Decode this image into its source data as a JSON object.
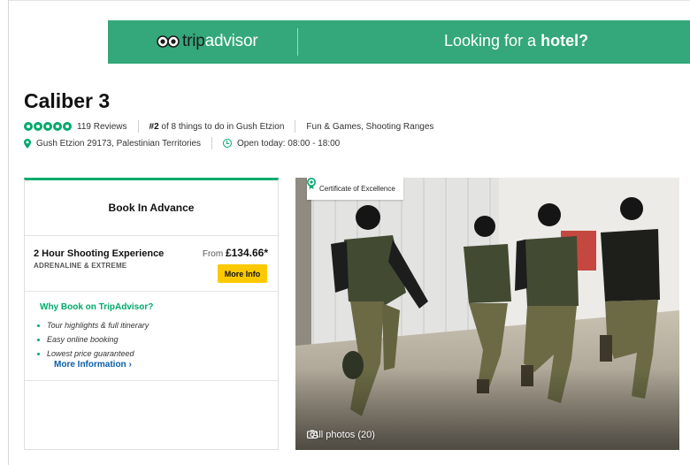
{
  "banner": {
    "logo_prefix": "trip",
    "logo_suffix": "advisor",
    "tagline_prefix": "Looking for a ",
    "tagline_emphasis": "hotel?"
  },
  "attraction": {
    "name": "Caliber 3",
    "rating_bubbles": 5,
    "reviews": "119 Reviews",
    "rank_number": "#2",
    "rank_text": " of 8 things to do in Gush Etzion",
    "categories": "Fun & Games, Shooting Ranges",
    "address": "Gush Etzion 29173, Palestinian Territories",
    "hours": "Open today: 08:00 - 18:00"
  },
  "booking": {
    "heading": "Book In Advance",
    "product_name": "2 Hour Shooting Experience",
    "product_category": "ADRENALINE & EXTREME",
    "price_prefix": "From ",
    "price": "£134.66*",
    "more_info_button": "More Info",
    "why_title": "Why Book on TripAdvisor?",
    "benefits": [
      "Tour highlights & full itinerary",
      "Easy online booking",
      "Lowest price guaranteed"
    ],
    "more_information_link": "More Information ›"
  },
  "photo": {
    "badge": "Certificate of Excellence",
    "all_photos_label": "All photos (20)"
  },
  "colors": {
    "brand_green": "#34a87a",
    "bubble_green": "#00aa6c",
    "button_yellow": "#fcc900",
    "link_blue": "#0a5ea8"
  }
}
